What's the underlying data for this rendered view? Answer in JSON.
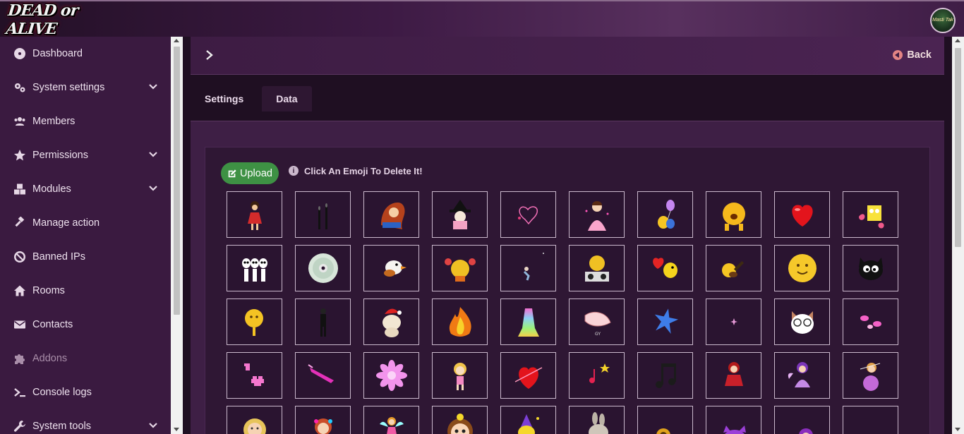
{
  "header": {
    "logo_text": "DEAD or ALIVE",
    "avatar_text": "Masti Tak"
  },
  "sidebar": {
    "items": [
      {
        "label": "Dashboard",
        "icon": "dashboard-icon",
        "has_chevron": false,
        "disabled": false
      },
      {
        "label": "System settings",
        "icon": "cogs-icon",
        "has_chevron": true,
        "disabled": false
      },
      {
        "label": "Members",
        "icon": "users-icon",
        "has_chevron": false,
        "disabled": false
      },
      {
        "label": "Permissions",
        "icon": "star-icon",
        "has_chevron": true,
        "disabled": false
      },
      {
        "label": "Modules",
        "icon": "cubes-icon",
        "has_chevron": true,
        "disabled": false
      },
      {
        "label": "Manage action",
        "icon": "gavel-icon",
        "has_chevron": false,
        "disabled": false
      },
      {
        "label": "Banned IPs",
        "icon": "ban-icon",
        "has_chevron": false,
        "disabled": false
      },
      {
        "label": "Rooms",
        "icon": "home-icon",
        "has_chevron": false,
        "disabled": false
      },
      {
        "label": "Contacts",
        "icon": "envelope-icon",
        "has_chevron": false,
        "disabled": false
      },
      {
        "label": "Addons",
        "icon": "puzzle-icon",
        "has_chevron": false,
        "disabled": true
      },
      {
        "label": "Console logs",
        "icon": "terminal-icon",
        "has_chevron": false,
        "disabled": false
      },
      {
        "label": "System tools",
        "icon": "wrench-icon",
        "has_chevron": true,
        "disabled": false
      }
    ]
  },
  "topbar": {
    "back_label": "Back"
  },
  "tabs": [
    {
      "label": "Settings",
      "active": false
    },
    {
      "label": "Data",
      "active": true
    }
  ],
  "emoji_panel": {
    "upload_label": "Upload",
    "hint": "Click An Emoji To Delete It!",
    "emojis": [
      "dancing-girl-emoji",
      "candles-emoji",
      "redhead-girl-emoji",
      "witch-emoji",
      "heart-doodle-emoji",
      "princess-emoji",
      "balloon-duck-emoji",
      "crying-smiley-emoji",
      "red-heart-emoji",
      "sponge-emoji",
      "skeletons-emoji",
      "cd-disc-emoji",
      "bird-emoji",
      "pigtails-smiley-emoji",
      "tiny-dancer-emoji",
      "dj-smiley-emoji",
      "heart-duck-emoji",
      "guitar-smiley-emoji",
      "smiley-face-emoji",
      "black-cat-emoji",
      "thinking-smiley-emoji",
      "dark-figure-emoji",
      "christmas-puppy-emoji",
      "flame-emoji",
      "rainbow-shape-emoji",
      "fish-emoji",
      "blue-star-emoji",
      "sparkle-emoji",
      "cat-glasses-emoji",
      "pink-candy-emoji",
      "pixel-hearts-emoji",
      "pink-streak-emoji",
      "pink-flower-emoji",
      "blonde-girl-emoji",
      "heart-arrow-emoji",
      "music-note-emoji",
      "double-notes-emoji",
      "red-doll-emoji",
      "purple-fairy-emoji",
      "bubble-girl-emoji",
      "curly-girl-emoji",
      "flower-girl-emoji",
      "fairy-emoji",
      "cute-baby-emoji",
      "party-bird-emoji",
      "bunny-emoji",
      "sunflower-emoji",
      "purple-cat-emoji",
      "heart-girl-emoji",
      "blank-emoji"
    ]
  },
  "colors": {
    "sidebar_bg": "#3a1a40",
    "header_bg": "#4b2452",
    "upload_green": "#3e9144",
    "back_icon": "#e38484"
  }
}
